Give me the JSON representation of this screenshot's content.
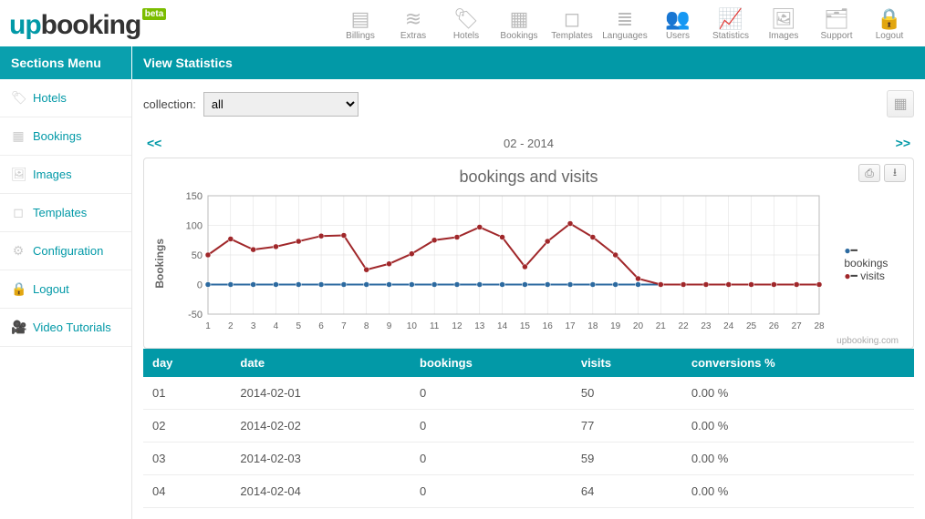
{
  "logo": {
    "prefix": "up",
    "rest": "booking",
    "badge": "beta"
  },
  "topnav": [
    {
      "name": "billings",
      "label": "Billings",
      "icon": "▤"
    },
    {
      "name": "extras",
      "label": "Extras",
      "icon": "≋"
    },
    {
      "name": "hotels",
      "label": "Hotels",
      "icon": "🏷"
    },
    {
      "name": "bookings",
      "label": "Bookings",
      "icon": "▦"
    },
    {
      "name": "templates",
      "label": "Templates",
      "icon": "◻"
    },
    {
      "name": "languages",
      "label": "Languages",
      "icon": "≣"
    },
    {
      "name": "users",
      "label": "Users",
      "icon": "👥"
    },
    {
      "name": "statistics",
      "label": "Statistics",
      "icon": "📈"
    },
    {
      "name": "images",
      "label": "Images",
      "icon": "🖼"
    },
    {
      "name": "support",
      "label": "Support",
      "icon": "🗂"
    },
    {
      "name": "logout",
      "label": "Logout",
      "icon": "🔒"
    }
  ],
  "sections_menu_label": "Sections Menu",
  "page_title": "View Statistics",
  "sidebar": [
    {
      "name": "hotels",
      "label": "Hotels",
      "icon": "🏷"
    },
    {
      "name": "bookings",
      "label": "Bookings",
      "icon": "▦"
    },
    {
      "name": "images",
      "label": "Images",
      "icon": "🖼"
    },
    {
      "name": "templates",
      "label": "Templates",
      "icon": "◻"
    },
    {
      "name": "configuration",
      "label": "Configuration",
      "icon": "⚙"
    },
    {
      "name": "logout",
      "label": "Logout",
      "icon": "🔒"
    },
    {
      "name": "video-tutorials",
      "label": "Video Tutorials",
      "icon": "🎥"
    }
  ],
  "collection": {
    "label": "collection:",
    "selected": "all",
    "options": [
      "all"
    ]
  },
  "period": {
    "prev": "<<",
    "label": "02 - 2014",
    "next": ">>"
  },
  "chart_title": "bookings and visits",
  "chart_ylabel": "Bookings",
  "legend": {
    "s1": "bookings",
    "s2": "visits"
  },
  "credit": "upbooking.com",
  "chart_data": {
    "type": "line",
    "x": [
      1,
      2,
      3,
      4,
      5,
      6,
      7,
      8,
      9,
      10,
      11,
      12,
      13,
      14,
      15,
      16,
      17,
      18,
      19,
      20,
      21,
      22,
      23,
      24,
      25,
      26,
      27,
      28
    ],
    "ylim": [
      -50,
      150
    ],
    "yticks": [
      -50,
      0,
      50,
      100,
      150
    ],
    "series": [
      {
        "name": "bookings",
        "color": "#2c6aa0",
        "values": [
          0,
          0,
          0,
          0,
          0,
          0,
          0,
          0,
          0,
          0,
          0,
          0,
          0,
          0,
          0,
          0,
          0,
          0,
          0,
          0,
          0,
          0,
          0,
          0,
          0,
          0,
          0,
          0
        ]
      },
      {
        "name": "visits",
        "color": "#a0272a",
        "values": [
          50,
          77,
          59,
          64,
          73,
          82,
          83,
          25,
          35,
          52,
          75,
          80,
          97,
          80,
          30,
          73,
          103,
          80,
          50,
          10,
          0,
          0,
          0,
          0,
          0,
          0,
          0,
          0
        ]
      }
    ]
  },
  "table": {
    "headers": [
      "day",
      "date",
      "bookings",
      "visits",
      "conversions %"
    ],
    "rows": [
      [
        "01",
        "2014-02-01",
        "0",
        "50",
        "0.00 %"
      ],
      [
        "02",
        "2014-02-02",
        "0",
        "77",
        "0.00 %"
      ],
      [
        "03",
        "2014-02-03",
        "0",
        "59",
        "0.00 %"
      ],
      [
        "04",
        "2014-02-04",
        "0",
        "64",
        "0.00 %"
      ]
    ]
  }
}
